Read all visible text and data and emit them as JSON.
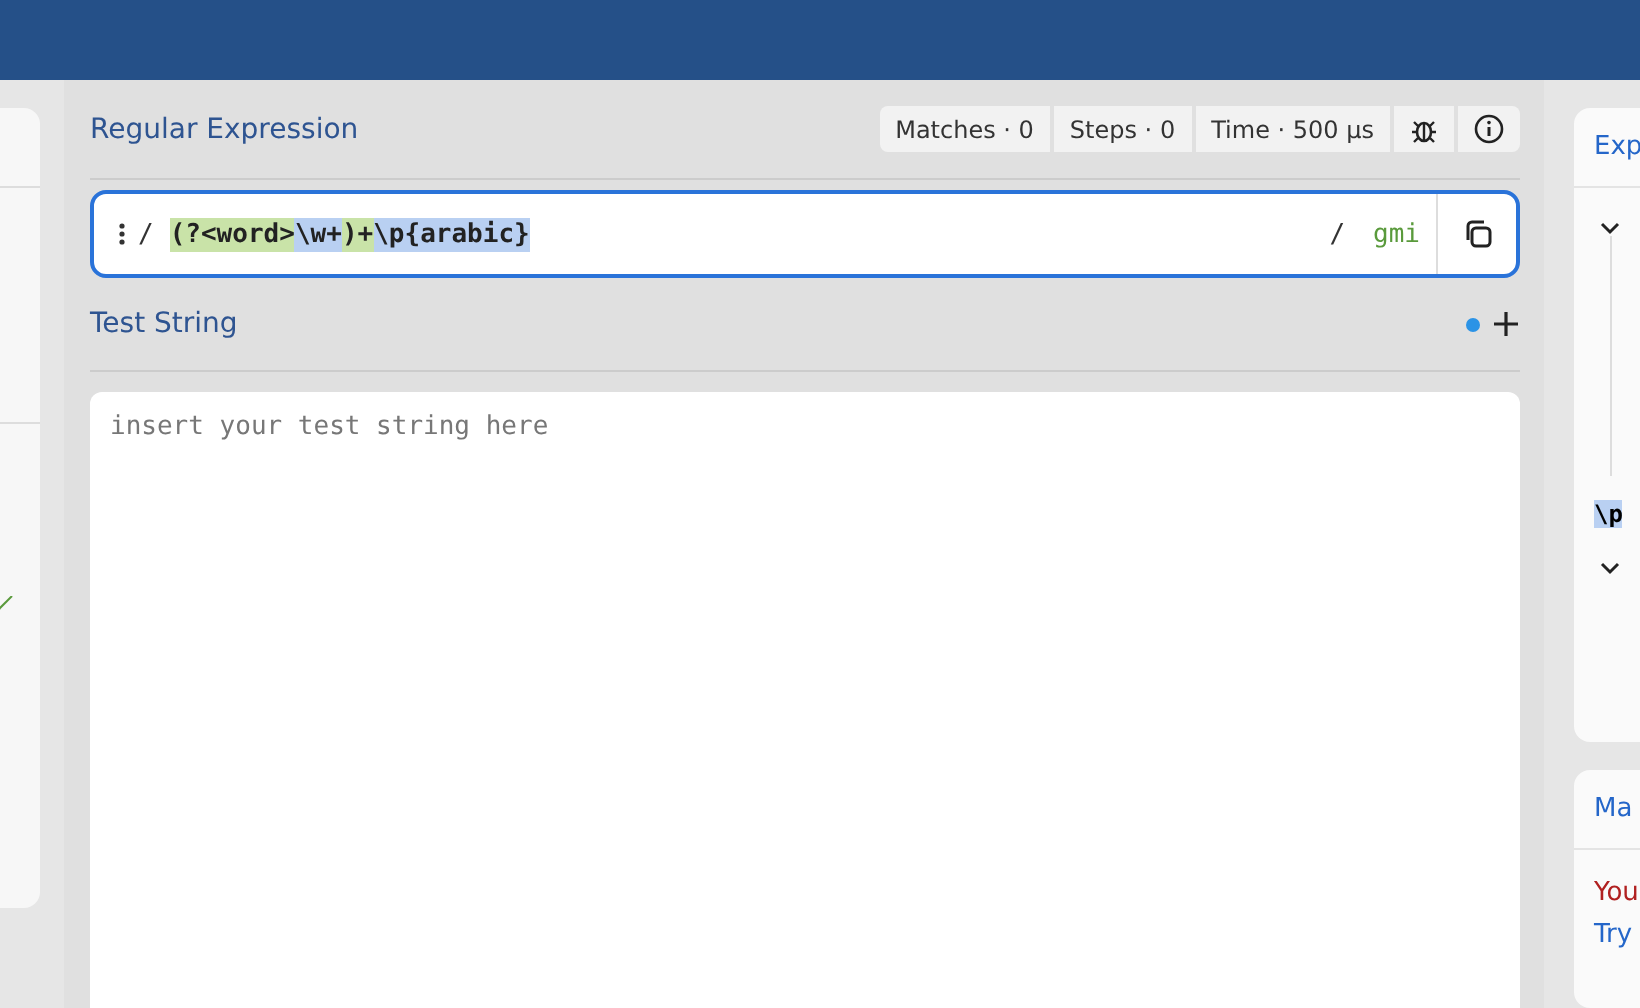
{
  "regex_panel": {
    "title": "Regular Expression",
    "stats": [
      "Matches · 0",
      "Steps · 0",
      "Time · 500 µs"
    ],
    "delimiter_open": "/",
    "delimiter_close": "/",
    "flags": "gmi",
    "tokens": [
      {
        "text": "(?<word>",
        "color": "#c9e3a8"
      },
      {
        "text": "\\w+",
        "color": "#b9d0f2"
      },
      {
        "text": ")+",
        "color": "#c9e3a8"
      },
      {
        "text": "\\p{arabic}",
        "color": "#b9d0f2"
      }
    ]
  },
  "test_string": {
    "title": "Test String",
    "placeholder": "insert your test string here"
  },
  "right_panel": {
    "explanation_title": "Exp",
    "explanation_token": "\\p",
    "match_title": "Ma",
    "match_message": "You",
    "match_link": "Try"
  }
}
